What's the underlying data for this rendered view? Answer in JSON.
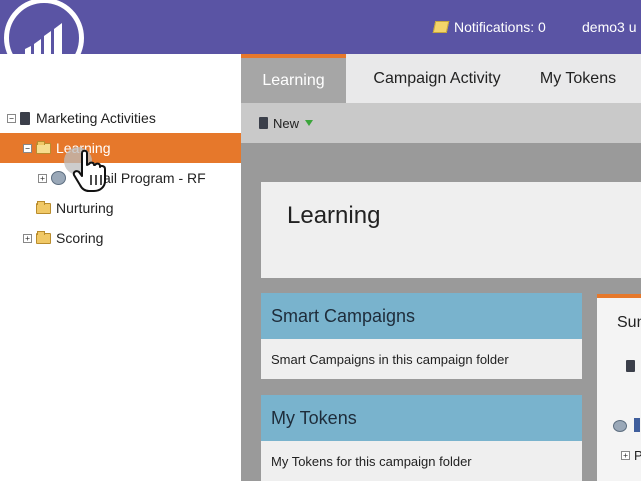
{
  "header": {
    "notifications_label": "Notifications: 0",
    "user_label": "demo3 u"
  },
  "tree": {
    "items": [
      {
        "label": "Marketing Activities"
      },
      {
        "label": "Learning"
      },
      {
        "label": "Email Program - RF"
      },
      {
        "label": "Nurturing"
      },
      {
        "label": "Scoring"
      }
    ]
  },
  "tabs": [
    {
      "label": "Learning"
    },
    {
      "label": "Campaign Activity"
    },
    {
      "label": "My Tokens"
    }
  ],
  "toolbar": {
    "new_label": "New"
  },
  "main": {
    "title": "Learning",
    "cards": [
      {
        "title": "Smart Campaigns",
        "body": "Smart Campaigns in this campaign folder"
      },
      {
        "title": "My Tokens",
        "body": "My Tokens for this campaign folder"
      }
    ],
    "summary": {
      "title": "Sum",
      "p_label": "P"
    }
  },
  "colors": {
    "header": "#5a54a4",
    "accent": "#e6782b",
    "card_header": "#79b3cd"
  }
}
